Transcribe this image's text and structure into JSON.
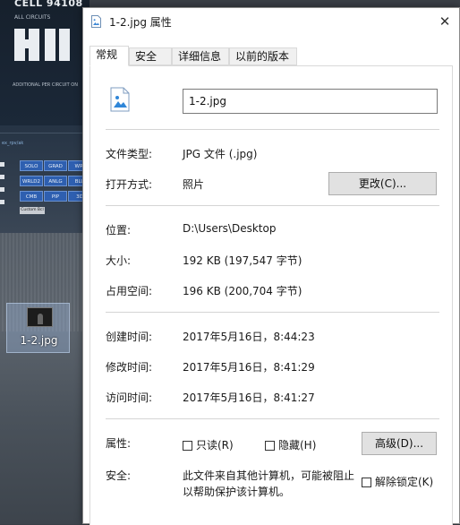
{
  "desktop": {
    "cell_title": "CELL 94108",
    "all_circuits": "ALL CIRCUITS",
    "additional": "ADDITIONAL PER CIRCUIT ON",
    "small_link": "ex_rpv/ak",
    "grid_buttons": [
      "SOLO",
      "GRAD",
      "WRI",
      "WRLD2",
      "ANLG",
      "BLU",
      "CMB",
      "PIP",
      "3D"
    ],
    "custom_button": "Custom Bcl",
    "file_label": "1-2.jpg"
  },
  "dialog": {
    "title": "1-2.jpg 属性",
    "tabs": [
      "常规",
      "安全",
      "详细信息",
      "以前的版本"
    ],
    "file_name": "1-2.jpg",
    "file_type_label": "文件类型:",
    "file_type_value": "JPG 文件 (.jpg)",
    "open_with_label": "打开方式:",
    "open_with_value": "照片",
    "change_button": "更改(C)...",
    "location_label": "位置:",
    "location_value": "D:\\Users\\Desktop",
    "size_label": "大小:",
    "size_value": "192 KB (197,547 字节)",
    "size_on_disk_label": "占用空间:",
    "size_on_disk_value": "196 KB (200,704 字节)",
    "created_label": "创建时间:",
    "created_value": "2017年5月16日，8:44:23",
    "modified_label": "修改时间:",
    "modified_value": "2017年5月16日，8:41:29",
    "accessed_label": "访问时间:",
    "accessed_value": "2017年5月16日，8:41:27",
    "attributes_label": "属性:",
    "readonly_label": "只读(R)",
    "hidden_label": "隐藏(H)",
    "advanced_button": "高级(D)...",
    "security_label": "安全:",
    "security_text_1": "此文件来自其他计算机，可能被阻止",
    "security_text_2": "以帮助保护该计算机。",
    "unblock_label": "解除锁定(K)"
  },
  "colors": {
    "tab_border": "#d9d9d9",
    "button_bg": "#e1e1e1",
    "grid_button": "#2e5fb0"
  }
}
